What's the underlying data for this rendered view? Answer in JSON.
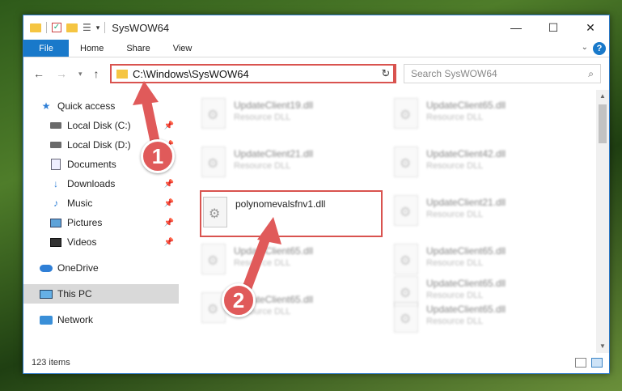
{
  "window": {
    "title": "SysWOW64",
    "controls": {
      "minimize": "—",
      "maximize": "☐",
      "close": "✕"
    }
  },
  "ribbon": {
    "tabs": [
      "File",
      "Home",
      "Share",
      "View"
    ],
    "help": "?"
  },
  "address": {
    "path": "C:\\Windows\\SysWOW64",
    "search_placeholder": "Search SysWOW64"
  },
  "sidebar": {
    "quick_access": "Quick access",
    "items": [
      {
        "label": "Local Disk (C:)",
        "icon": "disk-icon"
      },
      {
        "label": "Local Disk (D:)",
        "icon": "disk-icon"
      },
      {
        "label": "Documents",
        "icon": "documents-icon"
      },
      {
        "label": "Downloads",
        "icon": "downloads-icon"
      },
      {
        "label": "Music",
        "icon": "music-icon"
      },
      {
        "label": "Pictures",
        "icon": "pictures-icon"
      },
      {
        "label": "Videos",
        "icon": "videos-icon"
      }
    ],
    "onedrive": "OneDrive",
    "this_pc": "This PC",
    "network": "Network"
  },
  "files": {
    "left": [
      {
        "name": "UpdateClient19.dll",
        "type": "Resource DLL"
      },
      {
        "name": "UpdateClient21.dll",
        "type": "Resource DLL"
      },
      {
        "name": "polynomevalsfnv1.dll",
        "type": ""
      },
      {
        "name": "UpdateClient65.dll",
        "type": "Resource DLL"
      },
      {
        "name": "UpdateClient65.dll",
        "type": "Resource DLL"
      }
    ],
    "right": [
      {
        "name": "UpdateClient65.dll",
        "type": "Resource DLL"
      },
      {
        "name": "UpdateClient42.dll",
        "type": "Resource DLL"
      },
      {
        "name": "UpdateClient21.dll",
        "type": "Resource DLL"
      },
      {
        "name": "UpdateClient65.dll",
        "type": "Resource DLL"
      },
      {
        "name": "UpdateClient65.dll",
        "type": "Resource DLL"
      },
      {
        "name": "UpdateClient65.dll",
        "type": "Resource DLL"
      }
    ]
  },
  "status": {
    "count": "123 items"
  },
  "annotations": {
    "step1": "1",
    "step2": "2",
    "color": "#e05a5a"
  }
}
